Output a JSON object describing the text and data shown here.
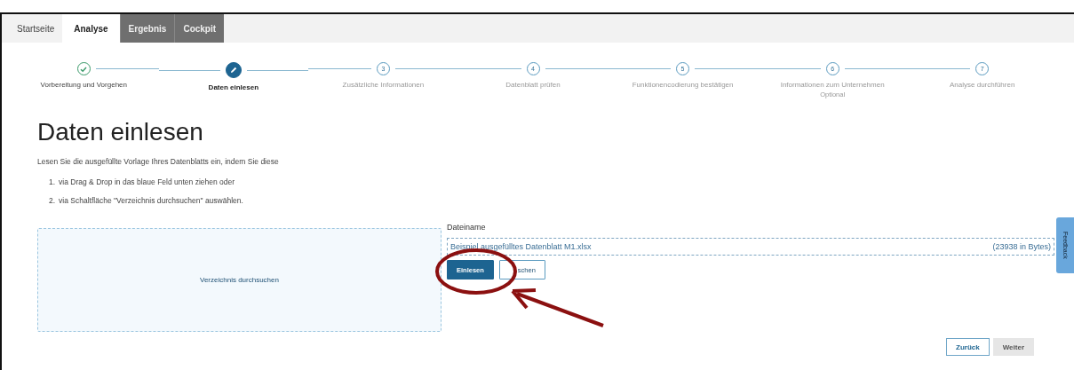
{
  "tabs": [
    {
      "label": "Startseite",
      "selected": false,
      "disabled": false
    },
    {
      "label": "Analyse",
      "selected": true,
      "disabled": false
    },
    {
      "label": "Ergebnis",
      "selected": false,
      "disabled": true
    },
    {
      "label": "Cockpit",
      "selected": false,
      "disabled": true
    }
  ],
  "steps": [
    {
      "label": "Vorbereitung und Vorgehen",
      "done": true,
      "current": false
    },
    {
      "label": "Daten einlesen",
      "done": false,
      "current": true
    },
    {
      "number": "3",
      "label": "Zusätzliche Informationen",
      "done": false,
      "current": false
    },
    {
      "number": "4",
      "label": "Datenblatt prüfen",
      "done": false,
      "current": false
    },
    {
      "number": "5",
      "label": "Funktionencodierung bestätigen",
      "done": false,
      "current": false
    },
    {
      "number": "6",
      "label": "Informationen zum Unternehmen",
      "note": "Optional",
      "done": false,
      "current": false
    },
    {
      "number": "7",
      "label": "Analyse durchführen",
      "done": false,
      "current": false
    }
  ],
  "heading": "Daten einlesen",
  "intro": "Lesen Sie die ausgefüllte Vorlage Ihres Datenblatts ein, indem Sie diese",
  "instructions": [
    {
      "number": "1.",
      "text": "via Drag & Drop in das blaue Feld unten ziehen oder"
    },
    {
      "number": "2.",
      "text": "via Schaltfläche \"Verzeichnis durchsuchen\" auswählen."
    }
  ],
  "drop_zone": {
    "label": "Verzeichnis durchsuchen"
  },
  "file": {
    "label": "Dateiname",
    "name": "Beispiel ausgefülltes Datenblatt M1.xlsx",
    "size": "(23938 in Bytes)"
  },
  "file_buttons": [
    {
      "label": "Einlesen",
      "primary": true
    },
    {
      "label": "schen",
      "primary": false
    }
  ],
  "feedback": "Feedback",
  "nav_buttons": [
    {
      "label": "Zurück",
      "primary": true
    },
    {
      "label": "Weiter",
      "primary": false
    }
  ]
}
